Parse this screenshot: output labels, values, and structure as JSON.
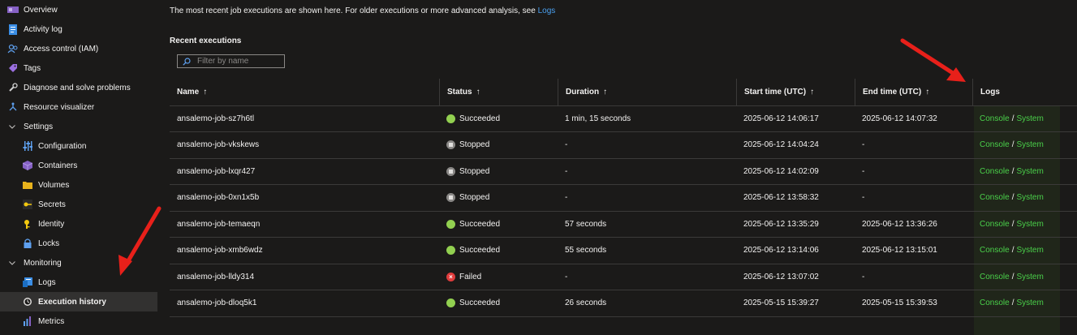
{
  "sidebar": {
    "items": [
      {
        "label": "Overview",
        "icon": "overview-icon"
      },
      {
        "label": "Activity log",
        "icon": "activity-log-icon"
      },
      {
        "label": "Access control (IAM)",
        "icon": "people-icon"
      },
      {
        "label": "Tags",
        "icon": "tag-icon"
      },
      {
        "label": "Diagnose and solve problems",
        "icon": "wrench-icon"
      },
      {
        "label": "Resource visualizer",
        "icon": "resource-graph-icon"
      }
    ],
    "settings": {
      "label": "Settings",
      "items": [
        {
          "label": "Configuration",
          "icon": "sliders-icon"
        },
        {
          "label": "Containers",
          "icon": "container-icon"
        },
        {
          "label": "Volumes",
          "icon": "folder-icon"
        },
        {
          "label": "Secrets",
          "icon": "key-icon"
        },
        {
          "label": "Identity",
          "icon": "identity-icon"
        },
        {
          "label": "Locks",
          "icon": "lock-icon"
        }
      ]
    },
    "monitoring": {
      "label": "Monitoring",
      "items": [
        {
          "label": "Logs",
          "icon": "logs-icon"
        },
        {
          "label": "Execution history",
          "icon": "history-icon",
          "active": true
        },
        {
          "label": "Metrics",
          "icon": "metrics-icon"
        }
      ]
    }
  },
  "main": {
    "intro_text": "The most recent job executions are shown here. For older executions or more advanced analysis, see ",
    "intro_link": "Logs",
    "section_title": "Recent executions",
    "filter_placeholder": "Filter by name",
    "columns": [
      "Name",
      "Status",
      "Duration",
      "Start time (UTC)",
      "End time (UTC)",
      "Logs"
    ],
    "sort_arrow": "↑",
    "log_links": {
      "console": "Console",
      "separator": "/",
      "system": "System"
    },
    "rows": [
      {
        "name": "ansalemo-job-sz7h6tl",
        "status": "Succeeded",
        "duration": "1 min, 15 seconds",
        "start": "2025-06-12 14:06:17",
        "end": "2025-06-12 14:07:32"
      },
      {
        "name": "ansalemo-job-vkskews",
        "status": "Stopped",
        "duration": "-",
        "start": "2025-06-12 14:04:24",
        "end": "-"
      },
      {
        "name": "ansalemo-job-lxqr427",
        "status": "Stopped",
        "duration": "-",
        "start": "2025-06-12 14:02:09",
        "end": "-"
      },
      {
        "name": "ansalemo-job-0xn1x5b",
        "status": "Stopped",
        "duration": "-",
        "start": "2025-06-12 13:58:32",
        "end": "-"
      },
      {
        "name": "ansalemo-job-temaeqn",
        "status": "Succeeded",
        "duration": "57 seconds",
        "start": "2025-06-12 13:35:29",
        "end": "2025-06-12 13:36:26"
      },
      {
        "name": "ansalemo-job-xmb6wdz",
        "status": "Succeeded",
        "duration": "55 seconds",
        "start": "2025-06-12 13:14:06",
        "end": "2025-06-12 13:15:01"
      },
      {
        "name": "ansalemo-job-lldy314",
        "status": "Failed",
        "duration": "-",
        "start": "2025-06-12 13:07:02",
        "end": "-"
      },
      {
        "name": "ansalemo-job-dloq5k1",
        "status": "Succeeded",
        "duration": "26 seconds",
        "start": "2025-05-15 15:39:27",
        "end": "2025-05-15 15:39:53"
      }
    ]
  },
  "colors": {
    "background": "#1b1a19",
    "link": "#4aa0f0",
    "log_link": "#4ad04a",
    "succeeded": "#92d050",
    "failed": "#e03c3c",
    "annotation_arrow": "#e8201a"
  }
}
